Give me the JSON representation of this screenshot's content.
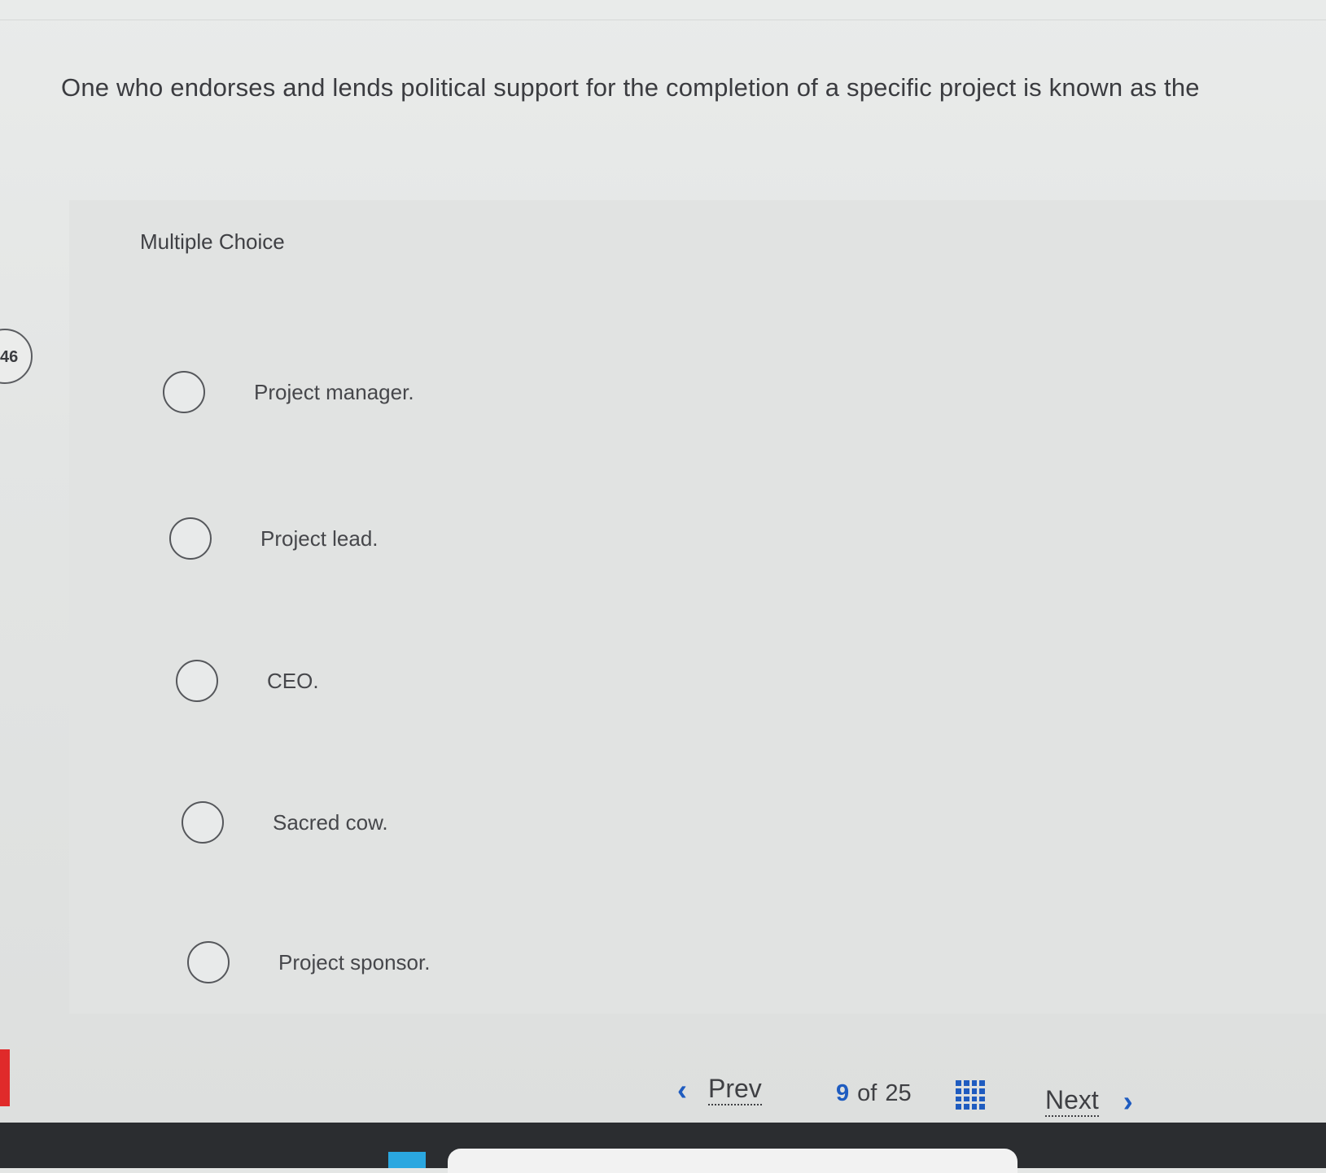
{
  "question": {
    "number": "46",
    "text": "One who endorses and lends political support for the completion of a specific project is known as the"
  },
  "section_label": "Multiple Choice",
  "options": [
    {
      "label": "Project manager."
    },
    {
      "label": "Project lead."
    },
    {
      "label": "CEO."
    },
    {
      "label": "Sacred cow."
    },
    {
      "label": "Project sponsor."
    }
  ],
  "navigation": {
    "prev_label": "Prev",
    "next_label": "Next",
    "current_page": "9",
    "separator": "of",
    "total_pages": "25",
    "prev_icon": "chevron-left-icon",
    "next_icon": "chevron-right-icon",
    "grid_icon": "question-grid-icon"
  },
  "colors": {
    "accent": "#1f5cc0",
    "background": "#e4e6e5",
    "text": "#3b3c40",
    "left_tab": "#e02a2a",
    "taskbar": "#2b2d30"
  }
}
